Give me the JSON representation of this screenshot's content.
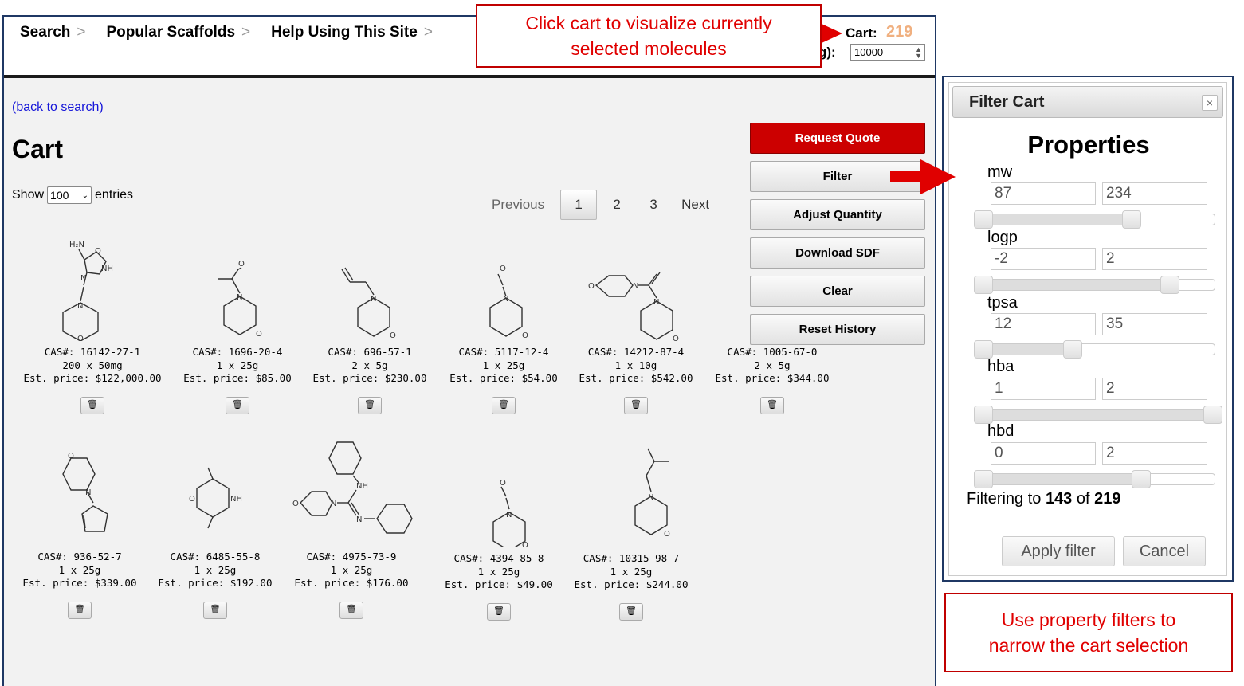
{
  "nav": {
    "items": [
      "Search",
      "Popular Scaffolds",
      "Help Using This Site"
    ],
    "separator": ">"
  },
  "header": {
    "cart_label": "Cart:",
    "cart_count": "219",
    "mg_label_partial": "g):",
    "mg_value": "10000"
  },
  "back_link": "(back to search)",
  "page_title": "Cart",
  "entries": {
    "show_label": "Show",
    "selected": "100",
    "entries_label": "entries"
  },
  "pager": {
    "previous": "Previous",
    "pages": [
      "1",
      "2",
      "3"
    ],
    "next": "Next",
    "active": "1"
  },
  "actions": [
    "Request Quote",
    "Filter",
    "Adjust Quantity",
    "Download SDF",
    "Clear",
    "Reset History"
  ],
  "molecules": [
    {
      "cas": "CAS#: 16142-27-1",
      "qty": "200 x 50mg",
      "price": "Est. price: $122,000.00"
    },
    {
      "cas": "CAS#: 1696-20-4",
      "qty": "1 x 25g",
      "price": "Est. price: $85.00"
    },
    {
      "cas": "CAS#: 696-57-1",
      "qty": "2 x 5g",
      "price": "Est. price: $230.00"
    },
    {
      "cas": "CAS#: 5117-12-4",
      "qty": "1 x 25g",
      "price": "Est. price: $54.00"
    },
    {
      "cas": "CAS#: 14212-87-4",
      "qty": "1 x 10g",
      "price": "Est. price: $542.00"
    },
    {
      "cas": "CAS#: 1005-67-0",
      "qty": "2 x 5g",
      "price": "Est. price: $344.00"
    },
    {
      "cas": "CAS#: 936-52-7",
      "qty": "1 x 25g",
      "price": "Est. price: $339.00"
    },
    {
      "cas": "CAS#: 6485-55-8",
      "qty": "1 x 25g",
      "price": "Est. price: $192.00"
    },
    {
      "cas": "CAS#: 4975-73-9",
      "qty": "1 x 25g",
      "price": "Est. price: $176.00"
    },
    {
      "cas": "CAS#: 4394-85-8",
      "qty": "1 x 25g",
      "price": "Est. price: $49.00"
    },
    {
      "cas": "CAS#: 10315-98-7",
      "qty": "1 x 25g",
      "price": "Est. price: $244.00"
    }
  ],
  "callouts": {
    "cart": [
      "Click cart to visualize currently",
      "selected molecules"
    ],
    "filter": [
      "Use property filters to",
      "narrow the cart selection"
    ]
  },
  "filter_dialog": {
    "title": "Filter Cart",
    "close": "×",
    "heading": "Properties",
    "properties": [
      {
        "name": "mw",
        "min": "87",
        "max": "234"
      },
      {
        "name": "logp",
        "min": "-2",
        "max": "2"
      },
      {
        "name": "tpsa",
        "min": "12",
        "max": "35"
      },
      {
        "name": "hba",
        "min": "1",
        "max": "2"
      },
      {
        "name": "hbd",
        "min": "0",
        "max": "2"
      }
    ],
    "status_prefix": "Filtering to",
    "filtered": "143",
    "status_of": "of",
    "total": "219",
    "apply": "Apply filter",
    "cancel": "Cancel"
  },
  "colors": {
    "accent_red": "#cc0000",
    "frame_navy": "#1f3864",
    "callout_red": "#e00000",
    "link_blue": "#1515d9",
    "cart_count": "#f0b080"
  },
  "icons": [
    "trash-icon",
    "close-icon",
    "arrow-right-icon",
    "chevron-down-icon"
  ]
}
